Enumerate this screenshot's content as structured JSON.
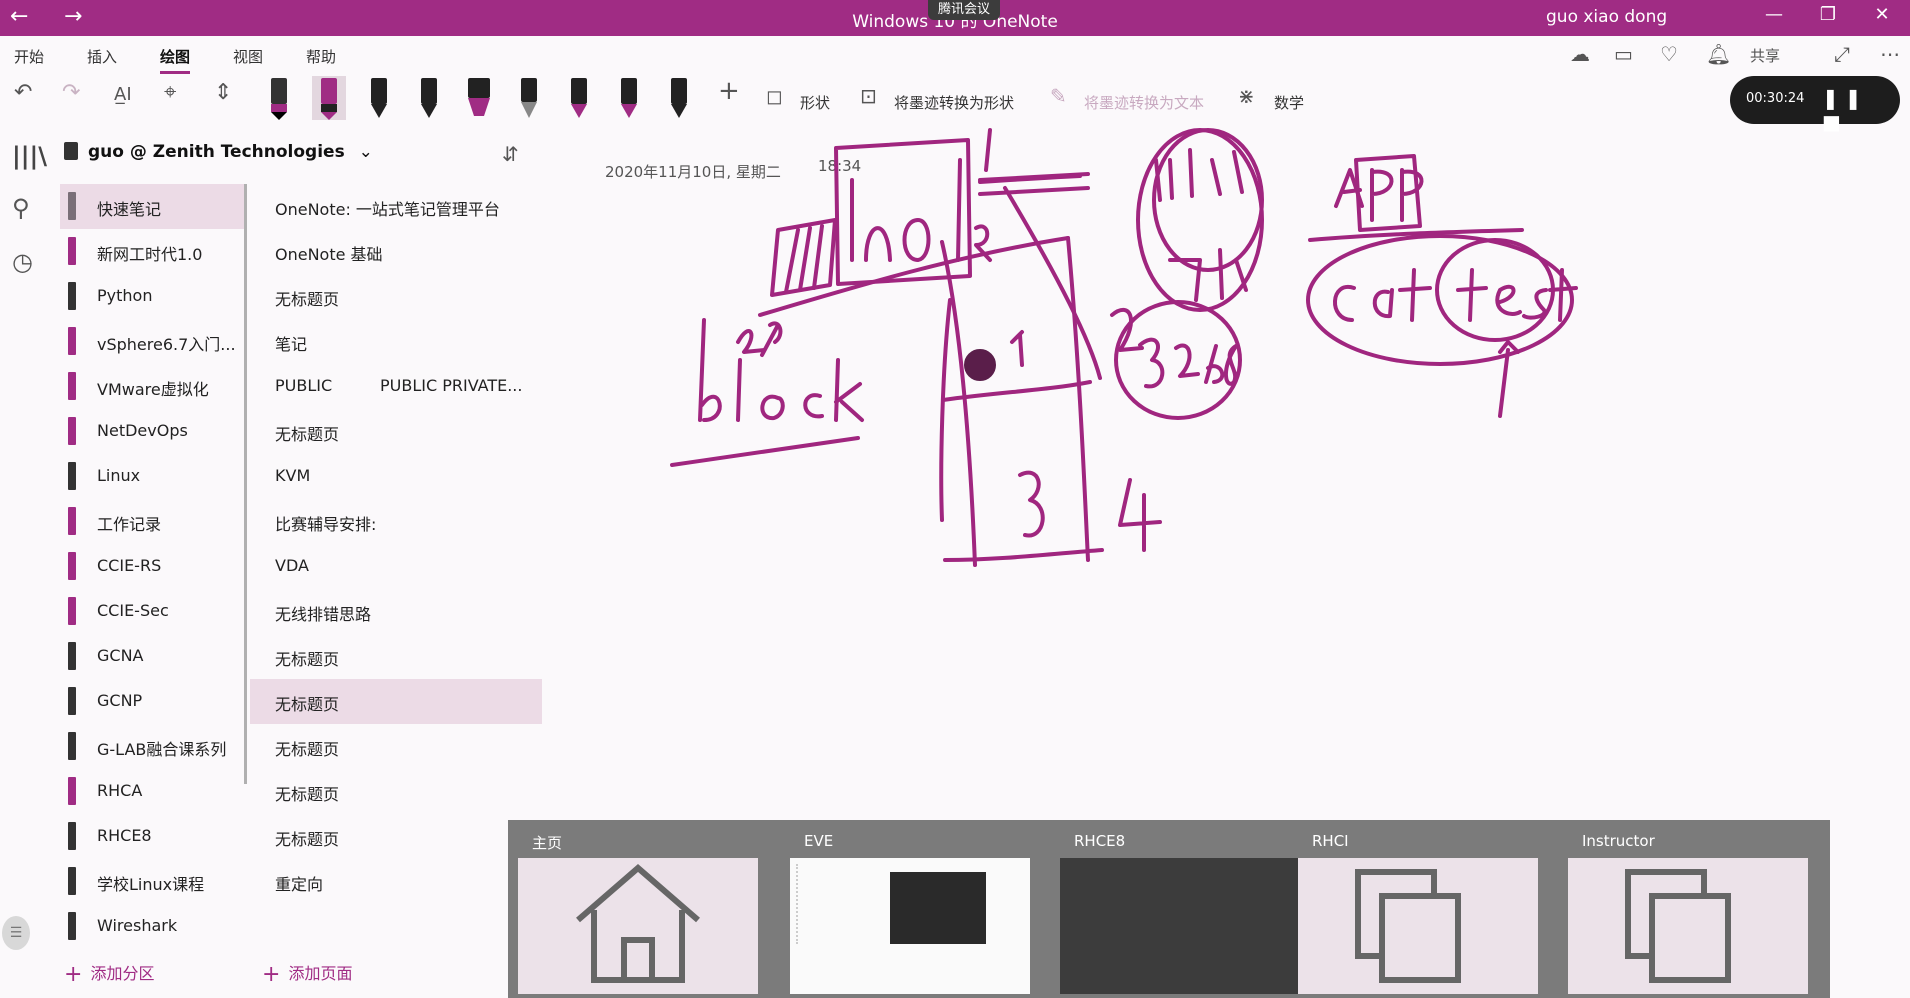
{
  "titlebar": {
    "title": "Windows 10 的 OneNote",
    "user": "guo xiao dong",
    "meeting": "腾讯会议",
    "back": "←",
    "forward": "→",
    "minimize": "—",
    "restore": "❐",
    "close": "✕"
  },
  "menu": {
    "items": [
      "开始",
      "插入",
      "绘图",
      "视图",
      "帮助"
    ],
    "share": "共享"
  },
  "toolbar": {
    "shapes": "形状",
    "ink_to_shape": "将墨迹转换为形状",
    "ink_to_text": "将墨迹转换为文本",
    "math": "数学",
    "recorder_time": "00:30:24",
    "pens": [
      {
        "tip": "#333333",
        "band": "#a02c84"
      },
      {
        "tip": "#a02c84",
        "band": "#a02c84"
      },
      {
        "tip": "#222222",
        "band": "#222222"
      },
      {
        "tip": "#222222",
        "band": "#222222"
      },
      {
        "tip": "#a02c84",
        "band": "#a02c84"
      },
      {
        "tip": "#666666",
        "band": "#222222"
      },
      {
        "tip": "#a02c84",
        "band": "#222222"
      },
      {
        "tip": "#a02c84",
        "band": "#222222"
      },
      {
        "tip": "#222222",
        "band": "#222222"
      }
    ]
  },
  "notebook": {
    "name": "guo @ Zenith Technologies"
  },
  "sections": [
    {
      "label": "快速笔记",
      "color": "#7a6f78"
    },
    {
      "label": "新网工时代1.0",
      "color": "#a02c84"
    },
    {
      "label": "Python",
      "color": "#333333"
    },
    {
      "label": "vSphere6.7入门...",
      "color": "#a02c84"
    },
    {
      "label": "VMware虚拟化",
      "color": "#a02c84"
    },
    {
      "label": "NetDevOps",
      "color": "#a02c84"
    },
    {
      "label": "Linux",
      "color": "#333333"
    },
    {
      "label": "工作记录",
      "color": "#a02c84"
    },
    {
      "label": "CCIE-RS",
      "color": "#a02c84"
    },
    {
      "label": "CCIE-Sec",
      "color": "#a02c84"
    },
    {
      "label": "GCNA",
      "color": "#333333"
    },
    {
      "label": "GCNP",
      "color": "#333333"
    },
    {
      "label": "G-LAB融合课系列",
      "color": "#333333"
    },
    {
      "label": "RHCA",
      "color": "#a02c84"
    },
    {
      "label": "RHCE8",
      "color": "#333333"
    },
    {
      "label": "学校Linux课程",
      "color": "#333333"
    },
    {
      "label": "Wireshark",
      "color": "#333333"
    }
  ],
  "pages": [
    {
      "label": "OneNote: 一站式笔记管理平台",
      "label2": ""
    },
    {
      "label": "OneNote 基础",
      "label2": ""
    },
    {
      "label": "无标题页",
      "label2": ""
    },
    {
      "label": "笔记",
      "label2": ""
    },
    {
      "label": "PUBLIC",
      "label2": "PUBLIC PRIVATE..."
    },
    {
      "label": "无标题页",
      "label2": ""
    },
    {
      "label": "KVM",
      "label2": ""
    },
    {
      "label": "比赛辅导安排:",
      "label2": ""
    },
    {
      "label": "VDA",
      "label2": ""
    },
    {
      "label": "无线排错思路",
      "label2": ""
    },
    {
      "label": "无标题页",
      "label2": ""
    },
    {
      "label": "无标题页",
      "label2": ""
    },
    {
      "label": "无标题页",
      "label2": ""
    },
    {
      "label": "无标题页",
      "label2": ""
    },
    {
      "label": "无标题页",
      "label2": ""
    },
    {
      "label": "重定向",
      "label2": ""
    }
  ],
  "add_section": "添加分区",
  "add_page": "添加页面",
  "canvas": {
    "date": "2020年11月10日, 星期二",
    "time": "18:34"
  },
  "switcher": {
    "cards": [
      "主页",
      "EVE",
      "RHCE8",
      "RHCI",
      "Instructor"
    ]
  },
  "colors": {
    "accent": "#a02c84",
    "ink": "#a0267f"
  }
}
